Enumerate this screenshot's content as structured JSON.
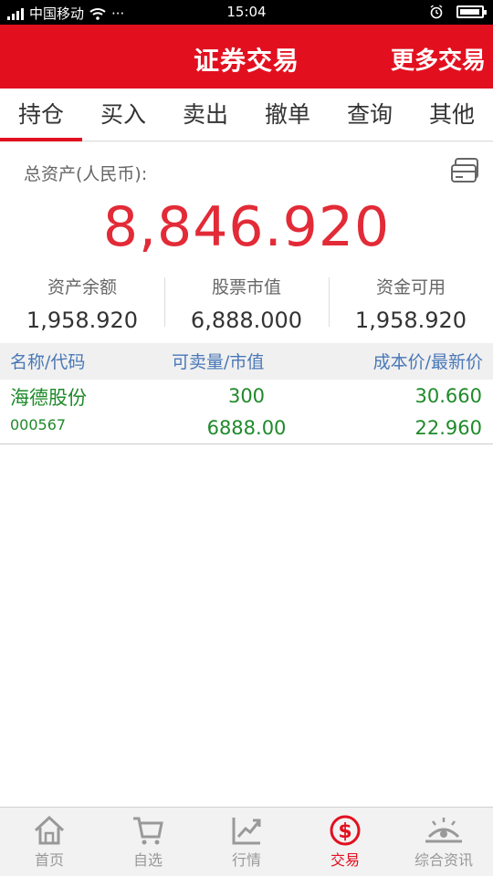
{
  "status_bar": {
    "carrier": "中国移动",
    "dots": "···",
    "time": "15:04"
  },
  "header": {
    "title": "证券交易",
    "more_label": "更多交易",
    "color": "#e2101f"
  },
  "tabs": [
    {
      "label": "持仓",
      "active": true
    },
    {
      "label": "买入"
    },
    {
      "label": "卖出"
    },
    {
      "label": "撤单"
    },
    {
      "label": "查询"
    },
    {
      "label": "其他"
    }
  ],
  "assets": {
    "label": "总资产(人民币):",
    "total": "8,846.920",
    "balance_label": "资产余额",
    "balance": "1,958.920",
    "market_label": "股票市值",
    "market_value": "6,888.000",
    "available_label": "资金可用",
    "available": "1,958.920"
  },
  "table": {
    "headers": [
      "名称/代码",
      "可卖量/市值",
      "成本价/最新价"
    ],
    "rows": [
      {
        "name": "海德股份",
        "code": "000567",
        "sellable": "300",
        "market_value": "6888.00",
        "cost_price": "30.660",
        "latest_price": "22.960"
      }
    ]
  },
  "bottom_nav": [
    {
      "label": "首页",
      "icon": "home-icon"
    },
    {
      "label": "自选",
      "icon": "cart-icon"
    },
    {
      "label": "行情",
      "icon": "chart-icon"
    },
    {
      "label": "交易",
      "icon": "dollar-icon",
      "active": true
    },
    {
      "label": "综合资讯",
      "icon": "eye-icon"
    }
  ]
}
